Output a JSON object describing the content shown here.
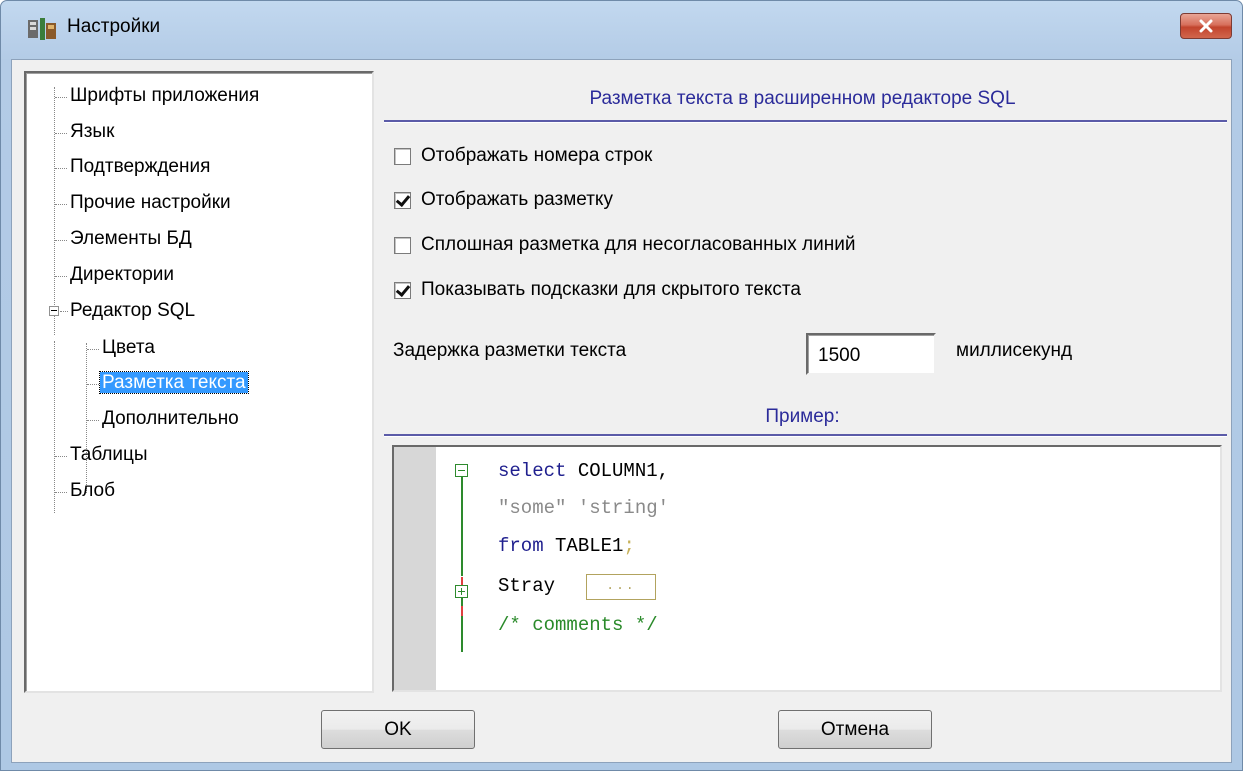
{
  "window": {
    "title": "Настройки",
    "close_icon": "close-icon"
  },
  "tree": {
    "items": [
      {
        "label": "Шрифты приложения"
      },
      {
        "label": "Язык"
      },
      {
        "label": "Подтверждения"
      },
      {
        "label": "Прочие настройки"
      },
      {
        "label": "Элементы БД"
      },
      {
        "label": "Директории"
      },
      {
        "label": "Редактор SQL",
        "expanded": true
      },
      {
        "label": "Цвета"
      },
      {
        "label": "Разметка текста",
        "selected": true
      },
      {
        "label": "Дополнительно"
      },
      {
        "label": "Таблицы"
      },
      {
        "label": "Блоб"
      }
    ]
  },
  "panel": {
    "heading": "Разметка текста в расширенном редакторе SQL",
    "checkboxes": [
      {
        "label": "Отображать номера строк",
        "checked": false
      },
      {
        "label": "Отображать разметку",
        "checked": true
      },
      {
        "label": "Сплошная разметка для несогласованных линий",
        "checked": false
      },
      {
        "label": "Показывать подсказки для скрытого текста",
        "checked": true
      }
    ],
    "delay_label": "Задержка разметки текста",
    "delay_value": "1500",
    "delay_unit": "миллисекунд",
    "example_heading": "Пример:"
  },
  "preview": {
    "line1_kw": "select",
    "line1_rest": " COLUMN1,",
    "line2": "\"some\" 'string'",
    "line3_kw": "from",
    "line3_rest": " TABLE1",
    "line3_semi": ";",
    "line4": "Stray ",
    "line4_box": "...",
    "line5": "/* comments */"
  },
  "buttons": {
    "ok": "OK",
    "cancel": "Отмена"
  },
  "colors": {
    "accent": "#2b2b9a",
    "selection": "#3399ff",
    "keyword": "#1f1f8e",
    "comment": "#2a8a2a"
  }
}
